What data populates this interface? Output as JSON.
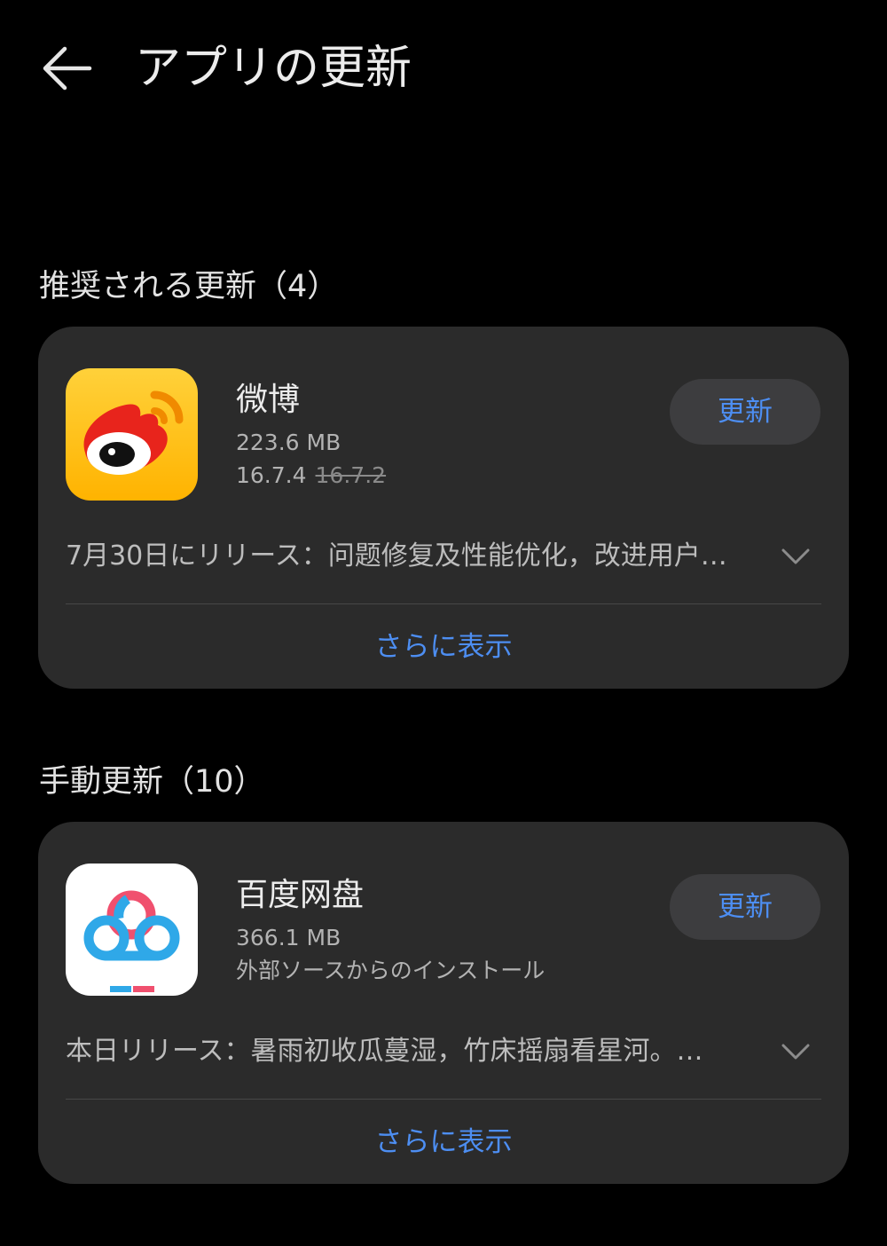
{
  "header": {
    "title": "アプリの更新",
    "back_icon": "arrow-left-icon"
  },
  "recommended": {
    "title": "推奨される更新（4）",
    "app": {
      "name": "微博",
      "size": "223.6 MB",
      "version_new": "16.7.4",
      "version_old": "16.7.2",
      "update_label": "更新",
      "release_note": "7月30日にリリース：问题修复及性能优化，改进用户…",
      "more_label": "さらに表示",
      "icon": "weibo-logo-icon"
    }
  },
  "manual": {
    "title": "手動更新（10）",
    "app": {
      "name": "百度网盘",
      "size": "366.1 MB",
      "source": "外部ソースからのインストール",
      "update_label": "更新",
      "release_note": "本日リリース：暑雨初收瓜蔓湿，竹床摇扇看星河。…",
      "more_label": "さらに表示",
      "icon": "baidu-netdisk-logo-icon"
    }
  },
  "colors": {
    "background": "#000000",
    "card": "#2b2b2b",
    "accent": "#4d8ef2",
    "button_bg": "#3d3d3f"
  }
}
